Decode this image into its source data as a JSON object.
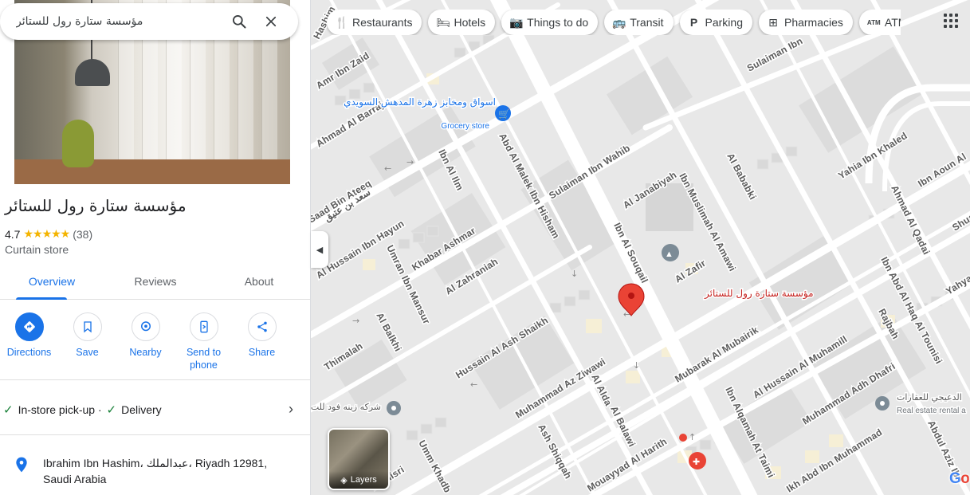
{
  "search": {
    "value": "مؤسسة ستارة رول للستائر"
  },
  "place": {
    "name": "مؤسسة ستارة رول للستائر",
    "rating": "4.7",
    "stars": "★★★★★",
    "reviews_count": "(38)",
    "category": "Curtain store"
  },
  "tabs": [
    {
      "label": "Overview"
    },
    {
      "label": "Reviews"
    },
    {
      "label": "About"
    }
  ],
  "actions": [
    {
      "label": "Directions",
      "icon": "directions-icon"
    },
    {
      "label": "Save",
      "icon": "bookmark-icon"
    },
    {
      "label": "Nearby",
      "icon": "nearby-icon"
    },
    {
      "label": "Send to phone",
      "icon": "send-to-phone-icon"
    },
    {
      "label": "Share",
      "icon": "share-icon"
    }
  ],
  "services": {
    "pickup": "In-store pick-up",
    "sep": " · ",
    "delivery": "Delivery"
  },
  "address": "Ibrahim Ibn Hashim، عبدالملك، Riyadh 12981, Saudi Arabia",
  "chips": [
    {
      "label": "Restaurants",
      "icon": "utensils-icon"
    },
    {
      "label": "Hotels",
      "icon": "bed-icon"
    },
    {
      "label": "Things to do",
      "icon": "camera-icon"
    },
    {
      "label": "Transit",
      "icon": "bus-icon"
    },
    {
      "label": "Parking",
      "icon": "parking-icon"
    },
    {
      "label": "Pharmacies",
      "icon": "pharmacy-icon"
    },
    {
      "label": "ATMs",
      "icon": "atm-icon"
    }
  ],
  "layers_label": "Layers",
  "map": {
    "streets": [
      "Amr Ibn Zaid",
      "Ahmad Al Barraj",
      "Saad Bin Ateeq",
      "سعد بن عتيق",
      "Al Hussain Ibn Hayun",
      "Ibn Al Ilm",
      "Umran Ibn Mansur",
      "Khabar Ashmar",
      "Al Zahraniah",
      "Abd Al Malek Ibn Hisham",
      "Sulaiman Ibn Wahib",
      "Al Janabiyah",
      "Ibn Al Souqail",
      "Ibn Muslimah Al Amawi",
      "Al Zafir",
      "Al Bababki",
      "Sulaiman Ibn",
      "Yahia Ibn Khaled",
      "Ibn Aoun Al",
      "Ahmad Al Qadai",
      "Shuaib",
      "Yahya Ib",
      "Ibn Abd Al Haq Al Tounisi",
      "Rajbah",
      "Al Balkhi",
      "Thimalah",
      "Hussain Al Ash Shaikh",
      "Muhammad Az Ziwawi",
      "Al Alda",
      "Al Balawi",
      "Ash Shiqqah",
      "Umm Khadb",
      "Al Misri",
      "Mouayyad Al Harith",
      "Mubarak Al Mubairik",
      "Ibn Alqamah At Taimi",
      "Al Hussain Al Muhamill",
      "Muhammad Adh Dhafri",
      "Ikh Abd Ibn Muhammad",
      "Abdul Aziz Ibn"
    ],
    "pois": [
      {
        "name": "اسواق ومخابز زهرة المدهش السويدي",
        "type": "Grocery store"
      },
      {
        "name": "مؤسسة ستارة رول للستائر",
        "type": ""
      },
      {
        "name": "شركه زينه فود للت",
        "type": ""
      },
      {
        "name": "الدعيجي للعقارات",
        "type": "Real estate rental a"
      }
    ]
  }
}
